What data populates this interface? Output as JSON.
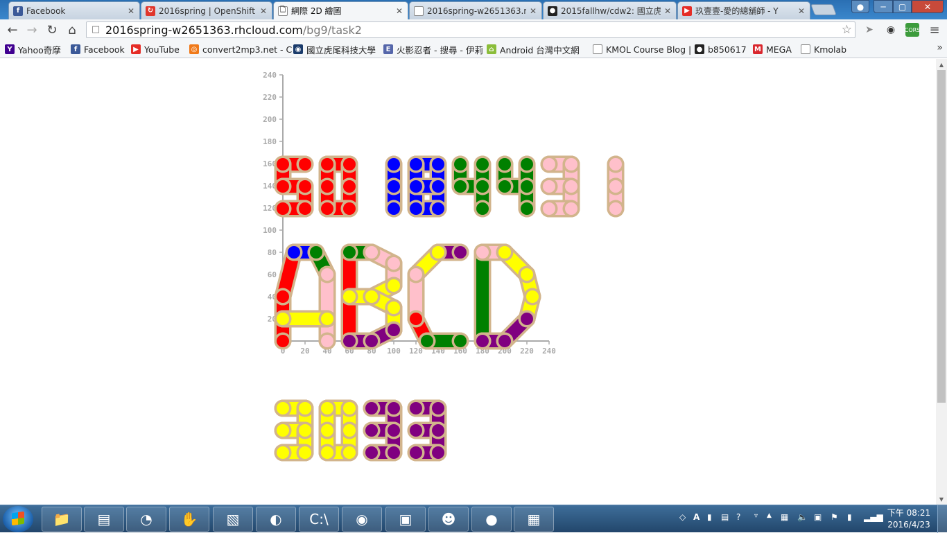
{
  "tabs": [
    {
      "title": "Facebook",
      "icon": "facebook-icon",
      "color": "#3b5998",
      "glyph": "f"
    },
    {
      "title": "2016spring | OpenShift O",
      "icon": "openshift-icon",
      "color": "#e0362c",
      "glyph": "↻"
    },
    {
      "title": "網際 2D 繪圖",
      "icon": "page-icon",
      "color": "#ffffff",
      "glyph": "🗋",
      "active": true
    },
    {
      "title": "2016spring-w2651363.rh",
      "icon": "page-icon",
      "color": "#ffffff",
      "glyph": ""
    },
    {
      "title": "2015fallhw/cdw2: 國立虎",
      "icon": "github-icon",
      "color": "#222222",
      "glyph": "●"
    },
    {
      "title": "玖壹壹-愛的總舖師 - Y",
      "icon": "youtube-icon",
      "color": "#e52d27",
      "glyph": "▶"
    }
  ],
  "address": {
    "host": "2016spring-w2651363.rhcloud.com",
    "path": "/bg9/task2"
  },
  "bookmarks": [
    {
      "label": "Yahoo奇摩",
      "icon": "yahoo-icon",
      "color": "#400090",
      "glyph": "Y"
    },
    {
      "label": "Facebook",
      "icon": "facebook-icon",
      "color": "#3b5998",
      "glyph": "f"
    },
    {
      "label": "YouTube",
      "icon": "youtube-icon",
      "color": "#e52d27",
      "glyph": "▶"
    },
    {
      "label": "convert2mp3.net - C",
      "icon": "convert-icon",
      "color": "#f07a1a",
      "glyph": "◎"
    },
    {
      "label": "國立虎尾科技大學",
      "icon": "nfu-icon",
      "color": "#1a3b6b",
      "glyph": "◉"
    },
    {
      "label": "火影忍者 - 搜尋 - 伊莉",
      "icon": "eyny-icon",
      "color": "#5566aa",
      "glyph": "E"
    },
    {
      "label": "Android 台灣中文網",
      "icon": "android-icon",
      "color": "#8bbd3a",
      "glyph": "⌂"
    },
    {
      "label": "KMOL Course Blog |",
      "icon": "page-icon",
      "color": "#ffffff",
      "glyph": ""
    },
    {
      "label": "b850617",
      "icon": "github-icon",
      "color": "#222222",
      "glyph": "●"
    },
    {
      "label": "MEGA",
      "icon": "mega-icon",
      "color": "#d9272e",
      "glyph": "M"
    },
    {
      "label": "Kmolab",
      "icon": "page-icon",
      "color": "#ffffff",
      "glyph": ""
    }
  ],
  "chart_data": {
    "type": "scatter",
    "xlim": [
      0,
      240
    ],
    "ylim": [
      0,
      240
    ],
    "x_ticks": [
      0,
      20,
      40,
      60,
      80,
      100,
      120,
      140,
      160,
      180,
      200,
      220,
      240
    ],
    "y_ticks": [
      20,
      40,
      60,
      80,
      100,
      120,
      140,
      160,
      180,
      200,
      220,
      240
    ],
    "palette": {
      "red": "#ff0000",
      "blue": "#0000ff",
      "green": "#008000",
      "pink": "#ffc0cb",
      "yellow": "#ffff00",
      "purple": "#800080",
      "outline": "#d2b48c"
    },
    "digit_groups": [
      {
        "text": "50184431",
        "colors": [
          "red",
          "red",
          "blue",
          "blue",
          "green",
          "green",
          "pink",
          "pink"
        ]
      },
      {
        "text": "3033",
        "colors": [
          "yellow",
          "yellow",
          "purple",
          "purple"
        ]
      }
    ],
    "letters": "ABCD"
  },
  "taskbar": {
    "apps": [
      {
        "name": "explorer-icon",
        "glyph": "📁"
      },
      {
        "name": "bluestacks-icon",
        "glyph": "▤"
      },
      {
        "name": "chrome-canary-icon",
        "glyph": "◔"
      },
      {
        "name": "cursor-tool-icon",
        "glyph": "✋"
      },
      {
        "name": "paint-icon",
        "glyph": "▧"
      },
      {
        "name": "firefox-icon",
        "glyph": "◐"
      },
      {
        "name": "cmd-icon",
        "glyph": "C:\\"
      },
      {
        "name": "chrome-icon",
        "glyph": "◉"
      },
      {
        "name": "network-monitor-icon",
        "glyph": "▣"
      },
      {
        "name": "game-icon",
        "glyph": "☻"
      },
      {
        "name": "sphere-icon",
        "glyph": "●"
      },
      {
        "name": "window-app-icon",
        "glyph": "▦"
      }
    ],
    "clock_time": "下午 08:21",
    "clock_date": "2016/4/23"
  }
}
